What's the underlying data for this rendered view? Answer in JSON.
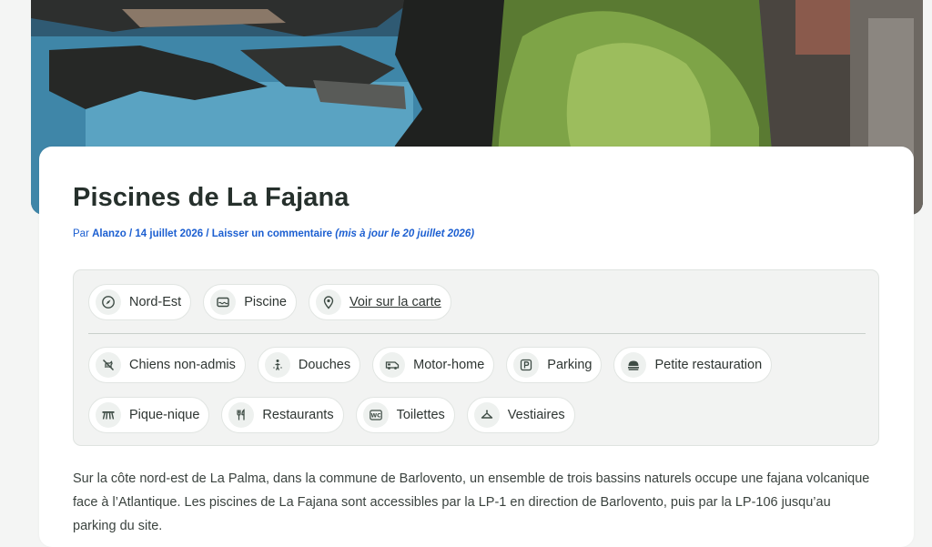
{
  "hero": {
    "image": "coastal-rock-pools-photo"
  },
  "article": {
    "title": "Piscines de La Fajana",
    "meta": {
      "prefix": "Par ",
      "author": "Alanzo",
      "sep1": " / ",
      "date": "14 juillet 2026",
      "sep2": " / ",
      "comment_link": "Laisser un commentaire",
      "updated": " (mis à jour le 20 juillet 2026)"
    },
    "intro": "Sur la côte nord-est de La Palma, dans la commune de Barlovento, un ensemble de trois bassins naturels occupe une fajana volcanique face à l’Atlantique. Les piscines de La Fajana sont accessibles par la LP-1 en direction de Barlovento, puis par la LP-106 jusqu’au parking du site."
  },
  "features": {
    "primary": [
      {
        "label": "Nord-Est",
        "icon": "compass-icon"
      },
      {
        "label": "Piscine",
        "icon": "pool-icon"
      },
      {
        "label": "Voir sur la carte",
        "icon": "map-pin-icon"
      }
    ],
    "amenities_row1": [
      {
        "label": "Chiens non-admis",
        "icon": "no-dogs-icon"
      },
      {
        "label": "Douches",
        "icon": "shower-icon"
      },
      {
        "label": "Motor-home",
        "icon": "motorhome-icon"
      },
      {
        "label": "Parking",
        "icon": "parking-icon"
      },
      {
        "label": "Petite restauration",
        "icon": "snack-icon"
      }
    ],
    "amenities_row2": [
      {
        "label": "Pique-nique",
        "icon": "picnic-table-icon"
      },
      {
        "label": "Restaurants",
        "icon": "cutlery-icon"
      },
      {
        "label": "Toilettes",
        "icon": "wc-icon"
      },
      {
        "label": "Vestiaires",
        "icon": "changing-room-icon"
      }
    ]
  },
  "colors": {
    "accent": "#1c5fd1",
    "icon": "#3e4c45",
    "panel": "#f2f3f2"
  }
}
